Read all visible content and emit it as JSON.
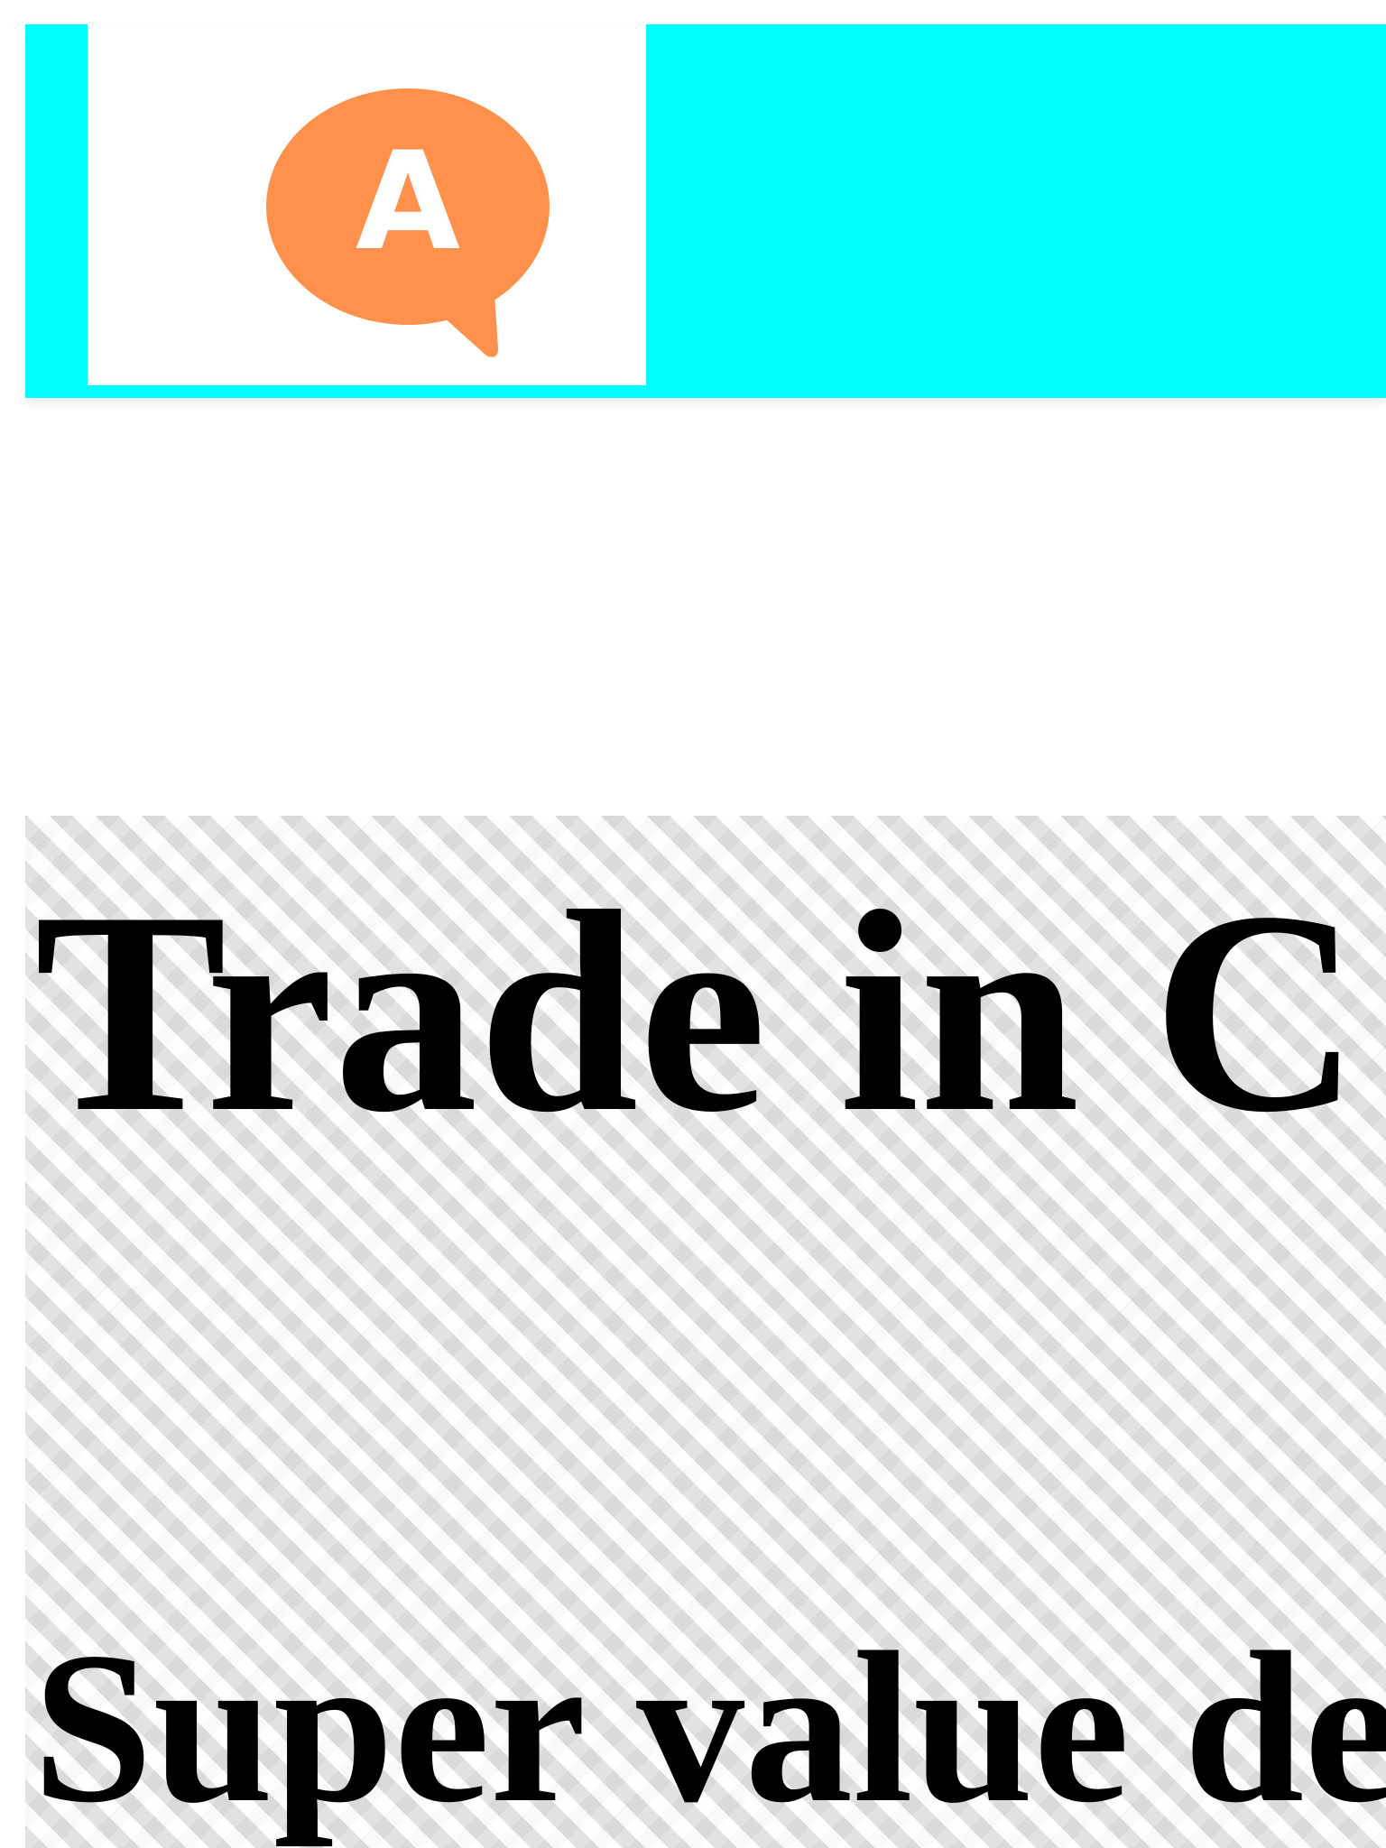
{
  "header": {
    "background_color": "#00ffff",
    "logo": {
      "icon": "speech-bubble-letter-a-icon",
      "letter": "A",
      "color": "#ff914d"
    }
  },
  "hero": {
    "title": "Trade in C",
    "subtitle": "Super value de",
    "background": "checkerboard-placeholder"
  }
}
